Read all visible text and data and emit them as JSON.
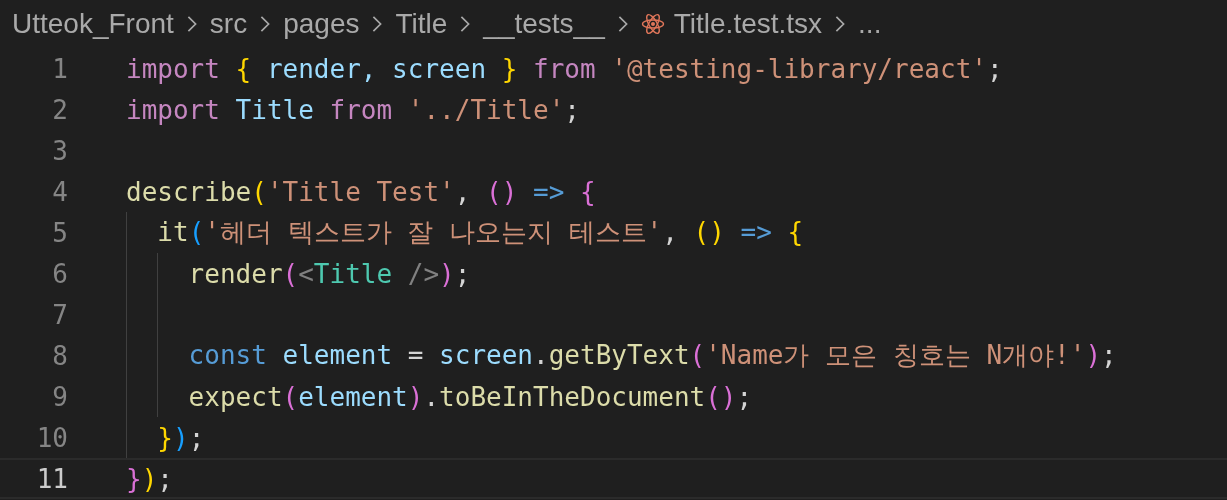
{
  "breadcrumb": [
    {
      "label": "Utteok_Front",
      "kind": "folder"
    },
    {
      "label": "src",
      "kind": "folder"
    },
    {
      "label": "pages",
      "kind": "folder"
    },
    {
      "label": "Title",
      "kind": "folder"
    },
    {
      "label": "__tests__",
      "kind": "folder"
    },
    {
      "label": "Title.test.tsx",
      "kind": "react-file"
    },
    {
      "label": "...",
      "kind": "more"
    }
  ],
  "lines": [
    {
      "number": "1",
      "current": false,
      "tokens": [
        {
          "kind": "keyword",
          "text": "import "
        },
        {
          "kind": "brace1",
          "text": "{"
        },
        {
          "kind": "variable",
          "text": " render, screen "
        },
        {
          "kind": "brace1",
          "text": "}"
        },
        {
          "kind": "keyword",
          "text": " from "
        },
        {
          "kind": "string",
          "text": "'@testing-library/react'"
        },
        {
          "kind": "punct",
          "text": ";"
        }
      ]
    },
    {
      "number": "2",
      "current": false,
      "tokens": [
        {
          "kind": "keyword",
          "text": "import "
        },
        {
          "kind": "variable",
          "text": "Title"
        },
        {
          "kind": "keyword",
          "text": " from "
        },
        {
          "kind": "string",
          "text": "'../Title'"
        },
        {
          "kind": "punct",
          "text": ";"
        }
      ]
    },
    {
      "number": "3",
      "current": false
    },
    {
      "number": "4",
      "current": false,
      "tokens": [
        {
          "kind": "function",
          "text": "describe"
        },
        {
          "kind": "brace1",
          "text": "("
        },
        {
          "kind": "string",
          "text": "'Title Test'"
        },
        {
          "kind": "punct",
          "text": ", "
        },
        {
          "kind": "brace2",
          "text": "() "
        },
        {
          "kind": "declaration",
          "text": "=> "
        },
        {
          "kind": "brace2",
          "text": "{"
        }
      ]
    },
    {
      "number": "5",
      "current": false,
      "tokens": [
        {
          "kind": "function",
          "text": "  it"
        },
        {
          "kind": "brace3",
          "text": "("
        },
        {
          "kind": "string",
          "text": "'헤더 텍스트가 잘 나오는지 테스트'"
        },
        {
          "kind": "punct",
          "text": ", "
        },
        {
          "kind": "brace1",
          "text": "() "
        },
        {
          "kind": "declaration",
          "text": "=> "
        },
        {
          "kind": "brace1",
          "text": "{"
        }
      ]
    },
    {
      "number": "6",
      "current": false,
      "tokens": [
        {
          "kind": "function",
          "text": "    render"
        },
        {
          "kind": "brace2",
          "text": "("
        },
        {
          "kind": "tag",
          "text": "<"
        },
        {
          "kind": "component",
          "text": "Title"
        },
        {
          "kind": "tag",
          "text": " />"
        },
        {
          "kind": "brace2",
          "text": ")"
        },
        {
          "kind": "punct",
          "text": ";"
        }
      ]
    },
    {
      "number": "7",
      "current": false
    },
    {
      "number": "8",
      "current": false,
      "tokens": [
        {
          "kind": "declaration",
          "text": "    const "
        },
        {
          "kind": "variable",
          "text": "element"
        },
        {
          "kind": "punct",
          "text": " = "
        },
        {
          "kind": "variable",
          "text": "screen"
        },
        {
          "kind": "punct",
          "text": "."
        },
        {
          "kind": "function",
          "text": "getByText"
        },
        {
          "kind": "brace2",
          "text": "("
        },
        {
          "kind": "string",
          "text": "'Name가 모은 칭호는 N개야!'"
        },
        {
          "kind": "brace2",
          "text": ")"
        },
        {
          "kind": "punct",
          "text": ";"
        }
      ]
    },
    {
      "number": "9",
      "current": false,
      "tokens": [
        {
          "kind": "function",
          "text": "    expect"
        },
        {
          "kind": "brace2",
          "text": "("
        },
        {
          "kind": "variable",
          "text": "element"
        },
        {
          "kind": "brace2",
          "text": ")"
        },
        {
          "kind": "punct",
          "text": "."
        },
        {
          "kind": "function",
          "text": "toBeInTheDocument"
        },
        {
          "kind": "brace2",
          "text": "()"
        },
        {
          "kind": "punct",
          "text": ";"
        }
      ]
    },
    {
      "number": "10",
      "current": false,
      "tokens": [
        {
          "kind": "brace1",
          "text": "  }"
        },
        {
          "kind": "brace3",
          "text": ")"
        },
        {
          "kind": "punct",
          "text": ";"
        }
      ]
    },
    {
      "number": "11",
      "current": true,
      "tokens": [
        {
          "kind": "brace2",
          "text": "}"
        },
        {
          "kind": "brace1",
          "text": ")"
        },
        {
          "kind": "punct",
          "text": ";"
        }
      ]
    }
  ]
}
